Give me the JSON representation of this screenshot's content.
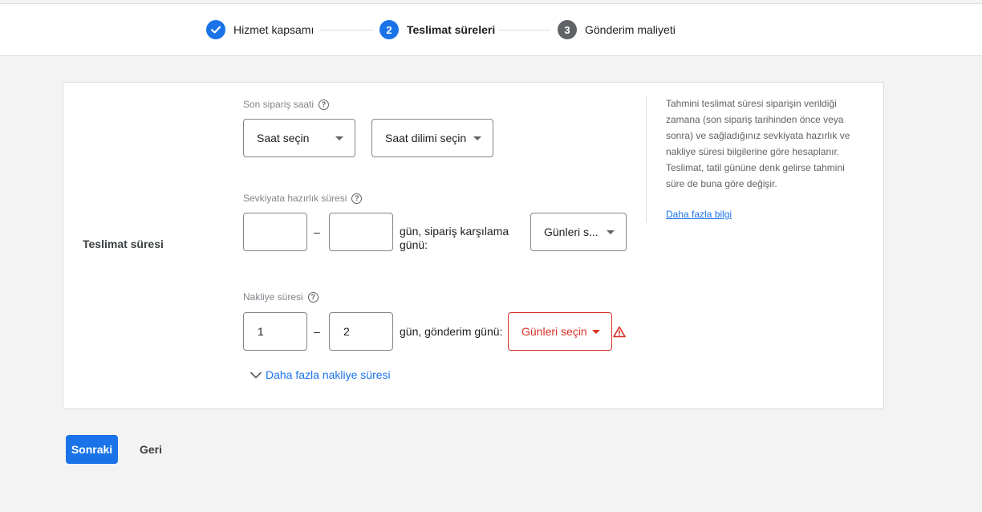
{
  "stepper": {
    "steps": [
      {
        "number": "",
        "label": "Hizmet kapsamı",
        "state": "completed"
      },
      {
        "number": "2",
        "label": "Teslimat süreleri",
        "state": "active"
      },
      {
        "number": "3",
        "label": "Gönderim maliyeti",
        "state": "upcoming"
      }
    ]
  },
  "section": {
    "label": "Teslimat süresi"
  },
  "cutoff": {
    "label": "Son sipariş saati",
    "time_select": "Saat seçin",
    "timezone_select": "Saat dilimi seçin"
  },
  "handling": {
    "label": "Sevkiyata hazırlık süresi",
    "min_value": "",
    "max_value": "",
    "dash": "–",
    "suffix": "gün, sipariş karşılama günü:",
    "days_select": "Günleri s..."
  },
  "transit": {
    "label": "Nakliye süresi",
    "min_value": "1",
    "max_value": "2",
    "dash": "–",
    "suffix": "gün, gönderim günü:",
    "days_select": "Günleri seçin",
    "days_select_state": "error"
  },
  "more_transit_link": "Daha fazla nakliye süresi",
  "info": {
    "text": "Tahmini teslimat süresi siparişin verildiği zamana (son sipariş tarihinden önce veya sonra) ve sağladığınız sevkiyata hazırlık ve nakliye süresi bilgilerine göre hesaplanır. Teslimat, tatil gününe denk gelirse tahmini süre de buna göre değişir.",
    "link": "Daha fazla bilgi"
  },
  "actions": {
    "next": "Sonraki",
    "back": "Geri"
  },
  "colors": {
    "accent": "#1a73e8",
    "error": "#d93025",
    "background": "#f3f3f3"
  }
}
